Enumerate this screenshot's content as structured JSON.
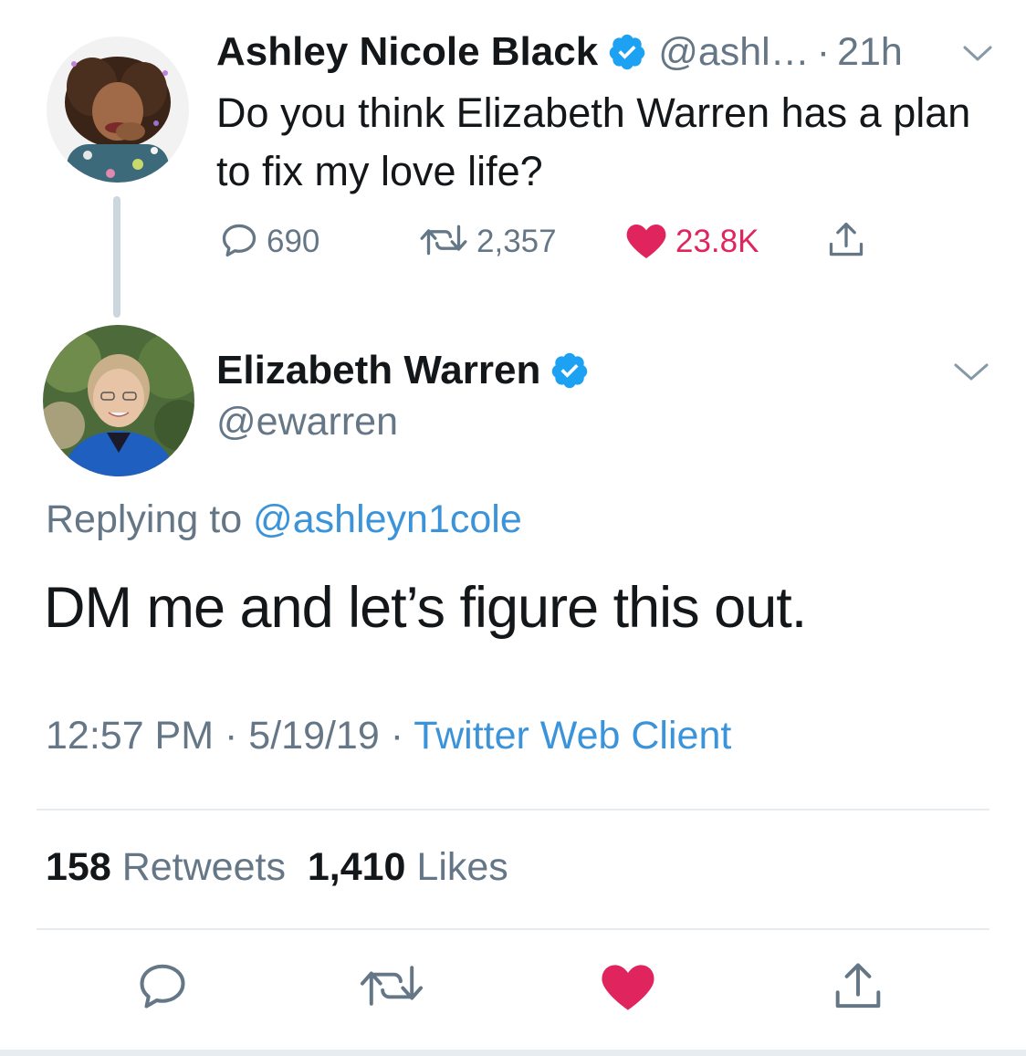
{
  "parent_tweet": {
    "author_name": "Ashley Nicole Black",
    "handle_truncated": "@ashl…",
    "separator": "·",
    "time": "21h",
    "text": "Do you think Elizabeth Warren has a plan to fix my love life?",
    "counts": {
      "replies": "690",
      "retweets": "2,357",
      "likes": "23.8K"
    }
  },
  "main_tweet": {
    "author_name": "Elizabeth Warren",
    "handle": "@ewarren",
    "replying_prefix": "Replying to",
    "replying_to": "@ashleyn1cole",
    "text": "DM me and let’s figure this out.",
    "time": "12:57 PM",
    "date": "5/19/19",
    "separator": "·",
    "client": "Twitter Web Client",
    "retweets_count": "158",
    "retweets_label": "Retweets",
    "likes_count": "1,410",
    "likes_label": "Likes"
  },
  "colors": {
    "text": "#14171a",
    "secondary": "#657786",
    "link": "#3b94d9",
    "verified": "#1da1f2",
    "like": "#e0245e",
    "divider": "#e6ecf0"
  },
  "icons": {
    "reply": "speech-bubble",
    "retweet": "two-arrows-loop",
    "like": "heart-filled",
    "share": "arrow-up-from-tray",
    "verified": "badge-check",
    "menu": "chevron-down"
  }
}
